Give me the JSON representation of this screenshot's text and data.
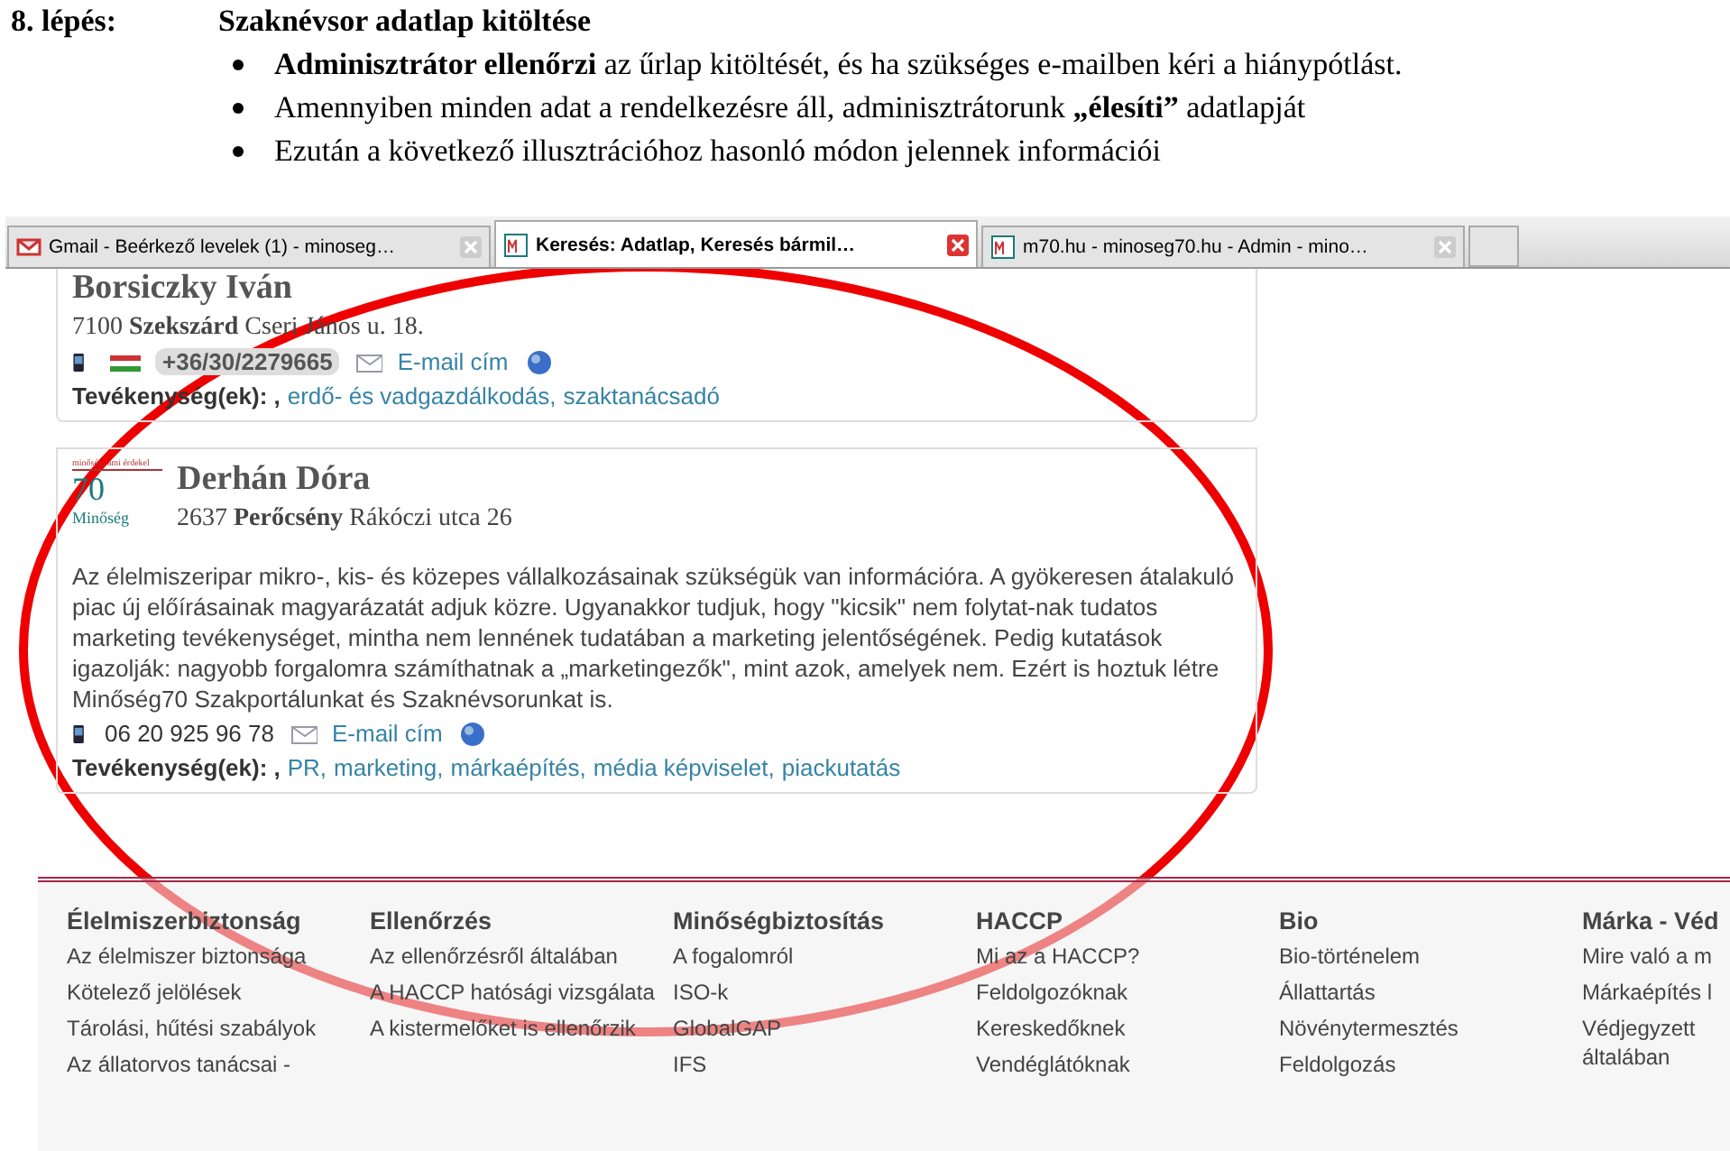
{
  "step": {
    "label": "8. lépés:",
    "title": "Szaknévsor adatlap kitöltése"
  },
  "bullets": [
    "**Adminisztrátor ellenőrzi** az űrlap kitöltését, és ha szükséges e-mailben kéri a hiánypótlást.",
    "Amennyiben minden adat a rendelkezésre áll, adminisztrátorunk **„élesíti”** adatlapját",
    "Ezután a következő illusztrációhoz hasonló módon jelennek információi"
  ],
  "browser_tabs": [
    {
      "title": "Gmail - Beérkező levelek (1) - minoseg…",
      "kind": "mail",
      "selected": false
    },
    {
      "title": "Keresés: Adatlap, Keresés bármil…",
      "kind": "site",
      "selected": true
    },
    {
      "title": "m70.hu - minoseg70.hu - Admin - mino…",
      "kind": "site",
      "selected": false
    }
  ],
  "entries": [
    {
      "name": "Borsiczky Iván",
      "zip": "7100",
      "city": "Szekszárd",
      "street": "Cseri János u. 18.",
      "phone": "+36/30/2279665",
      "flag_shown": true,
      "email": "E-mail cím",
      "activity_label": "Tevékenység(ek): ,",
      "activities": [
        "erdő- és vadgazdálkodás,",
        "szaktanácsadó"
      ]
    },
    {
      "name": "Derhán Dóra",
      "zip": "2637",
      "city": "Perőcsény",
      "street": "Rákóczi utca 26",
      "logo_text": "70",
      "logo_sub": "Minőség",
      "logo_tag": "minőség, ami érdekel",
      "description": "Az élelmiszeripar mikro-, kis- és közepes vállalkozásainak szükségük van információra. A gyökeresen átalakuló piac új előírásainak magyarázatát adjuk közre. Ugyanakkor tudjuk, hogy \"kicsik\" nem folytat-nak tudatos marketing tevékenységet, mintha nem lennének tudatában a marketing jelentőségének. Pedig kutatások igazolják: nagyobb forgalomra számíthatnak a „marketingezők\", mint azok, amelyek nem. Ezért is hoztuk létre Minőség70 Szakportálunkat és Szaknévsorunkat is.",
      "phone": "06 20 925 96 78",
      "flag_shown": false,
      "email": "E-mail cím",
      "activity_label": "Tevékenység(ek): ,",
      "activities": [
        "PR,",
        "marketing,",
        "márkaépítés,",
        "média képviselet,",
        "piackutatás"
      ]
    }
  ],
  "footer_columns": [
    {
      "heading": "Élelmiszerbiztonság",
      "links": [
        "Az élelmiszer biztonsága",
        "Kötelező jelölések",
        "Tárolási, hűtési szabályok",
        "Az állatorvos tanácsai -"
      ]
    },
    {
      "heading": "Ellenőrzés",
      "links": [
        "Az ellenőrzésről általában",
        "A HACCP hatósági vizsgálata",
        "A kistermelőket is ellenőrzik"
      ]
    },
    {
      "heading": "Minőségbiztosítás",
      "links": [
        "A fogalomról",
        "ISO-k",
        "GlobalGAP",
        "IFS"
      ]
    },
    {
      "heading": "HACCP",
      "links": [
        "Mi az a HACCP?",
        "Feldolgozóknak",
        "Kereskedőknek",
        "Vendéglátóknak"
      ]
    },
    {
      "heading": "Bio",
      "links": [
        "Bio-történelem",
        "Állattartás",
        "Növénytermesztés",
        "Feldolgozás"
      ]
    },
    {
      "heading": "Márka - Véd",
      "links": [
        "Mire való a m",
        "Márkaépítés l",
        "Védjegyzett általában"
      ]
    }
  ]
}
